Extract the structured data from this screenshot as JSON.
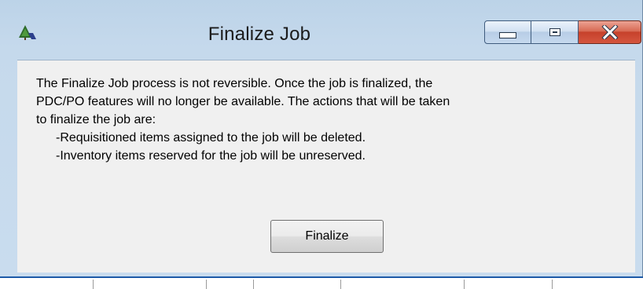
{
  "window": {
    "title": "Finalize Job",
    "icon": "app-tree-icon"
  },
  "caption_buttons": {
    "minimize_icon": "minimize-icon",
    "maximize_icon": "maximize-icon",
    "close_icon": "close-icon",
    "close_glyph": "✕"
  },
  "message": {
    "line1": "The Finalize Job process is not reversible.  Once the job is finalized, the",
    "line2": "PDC/PO features will no longer be available.  The actions that will be taken",
    "line3": "to finalize the job are:",
    "action1": "-Requisitioned items assigned to the job will be deleted.",
    "action2": "-Inventory items reserved for the job will be unreserved."
  },
  "buttons": {
    "finalize_label": "Finalize"
  },
  "colors": {
    "titlebar": "#c5d9ec",
    "client": "#f0f0f0",
    "close_button": "#c6412b",
    "background_window_border": "#1d5aa8"
  }
}
